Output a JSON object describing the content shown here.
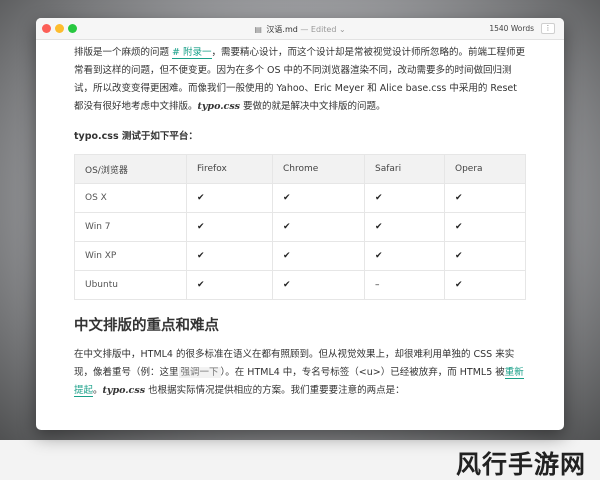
{
  "window": {
    "title": "汉语.md",
    "edited": "— Edited ⌄",
    "word_count": "1540 Words",
    "toolbar_button": "⋮"
  },
  "body": {
    "p1": {
      "t1": "排版是一个麻烦的问题 ",
      "link1": "# 附录一",
      "t2": "，需要精心设计，而这个设计却是常被视觉设计师所忽略的。前端工程师更常看到这样的问题，但不便变更。因为在多个 OS 中的不同浏览器渲染不同，改动需要多的时间做回归测试，所以改变变得更困难。而像我们一般使用的 Yahoo、Eric Meyer 和 Alice base.css 中采用的 Reset 都没有很好地考虑中文排版。",
      "mark": "typo.css",
      "t3": " 要做的就是解决中文排版的问题。"
    },
    "subtitle": "typo.css 测试于如下平台：",
    "table": {
      "headers": [
        "OS/浏览器",
        "Firefox",
        "Chrome",
        "Safari",
        "Opera"
      ],
      "rows": [
        [
          "OS X",
          "✔",
          "✔",
          "✔",
          "✔"
        ],
        [
          "Win 7",
          "✔",
          "✔",
          "✔",
          "✔"
        ],
        [
          "Win XP",
          "✔",
          "✔",
          "✔",
          "✔"
        ],
        [
          "Ubuntu",
          "✔",
          "✔",
          "–",
          "✔"
        ]
      ]
    },
    "heading": "中文排版的重点和难点",
    "p2": {
      "t1": "在中文排版中，HTML4 的很多标准在语义在都有照顾到。但从视觉效果上，却很难利用单独的 CSS 来实现，像着重号（例：这里",
      "hl": "强调一下",
      "t2": "）。在 HTML4 中，专名号标签（<u>）已经被放弃，而 HTML5 被",
      "link": "重新提起",
      "t3": "。",
      "mark": "typo.css",
      "t4": " 也根据实际情况提供相应的方案。我们重要要注意的两点是："
    }
  },
  "watermark": "风行手游网"
}
